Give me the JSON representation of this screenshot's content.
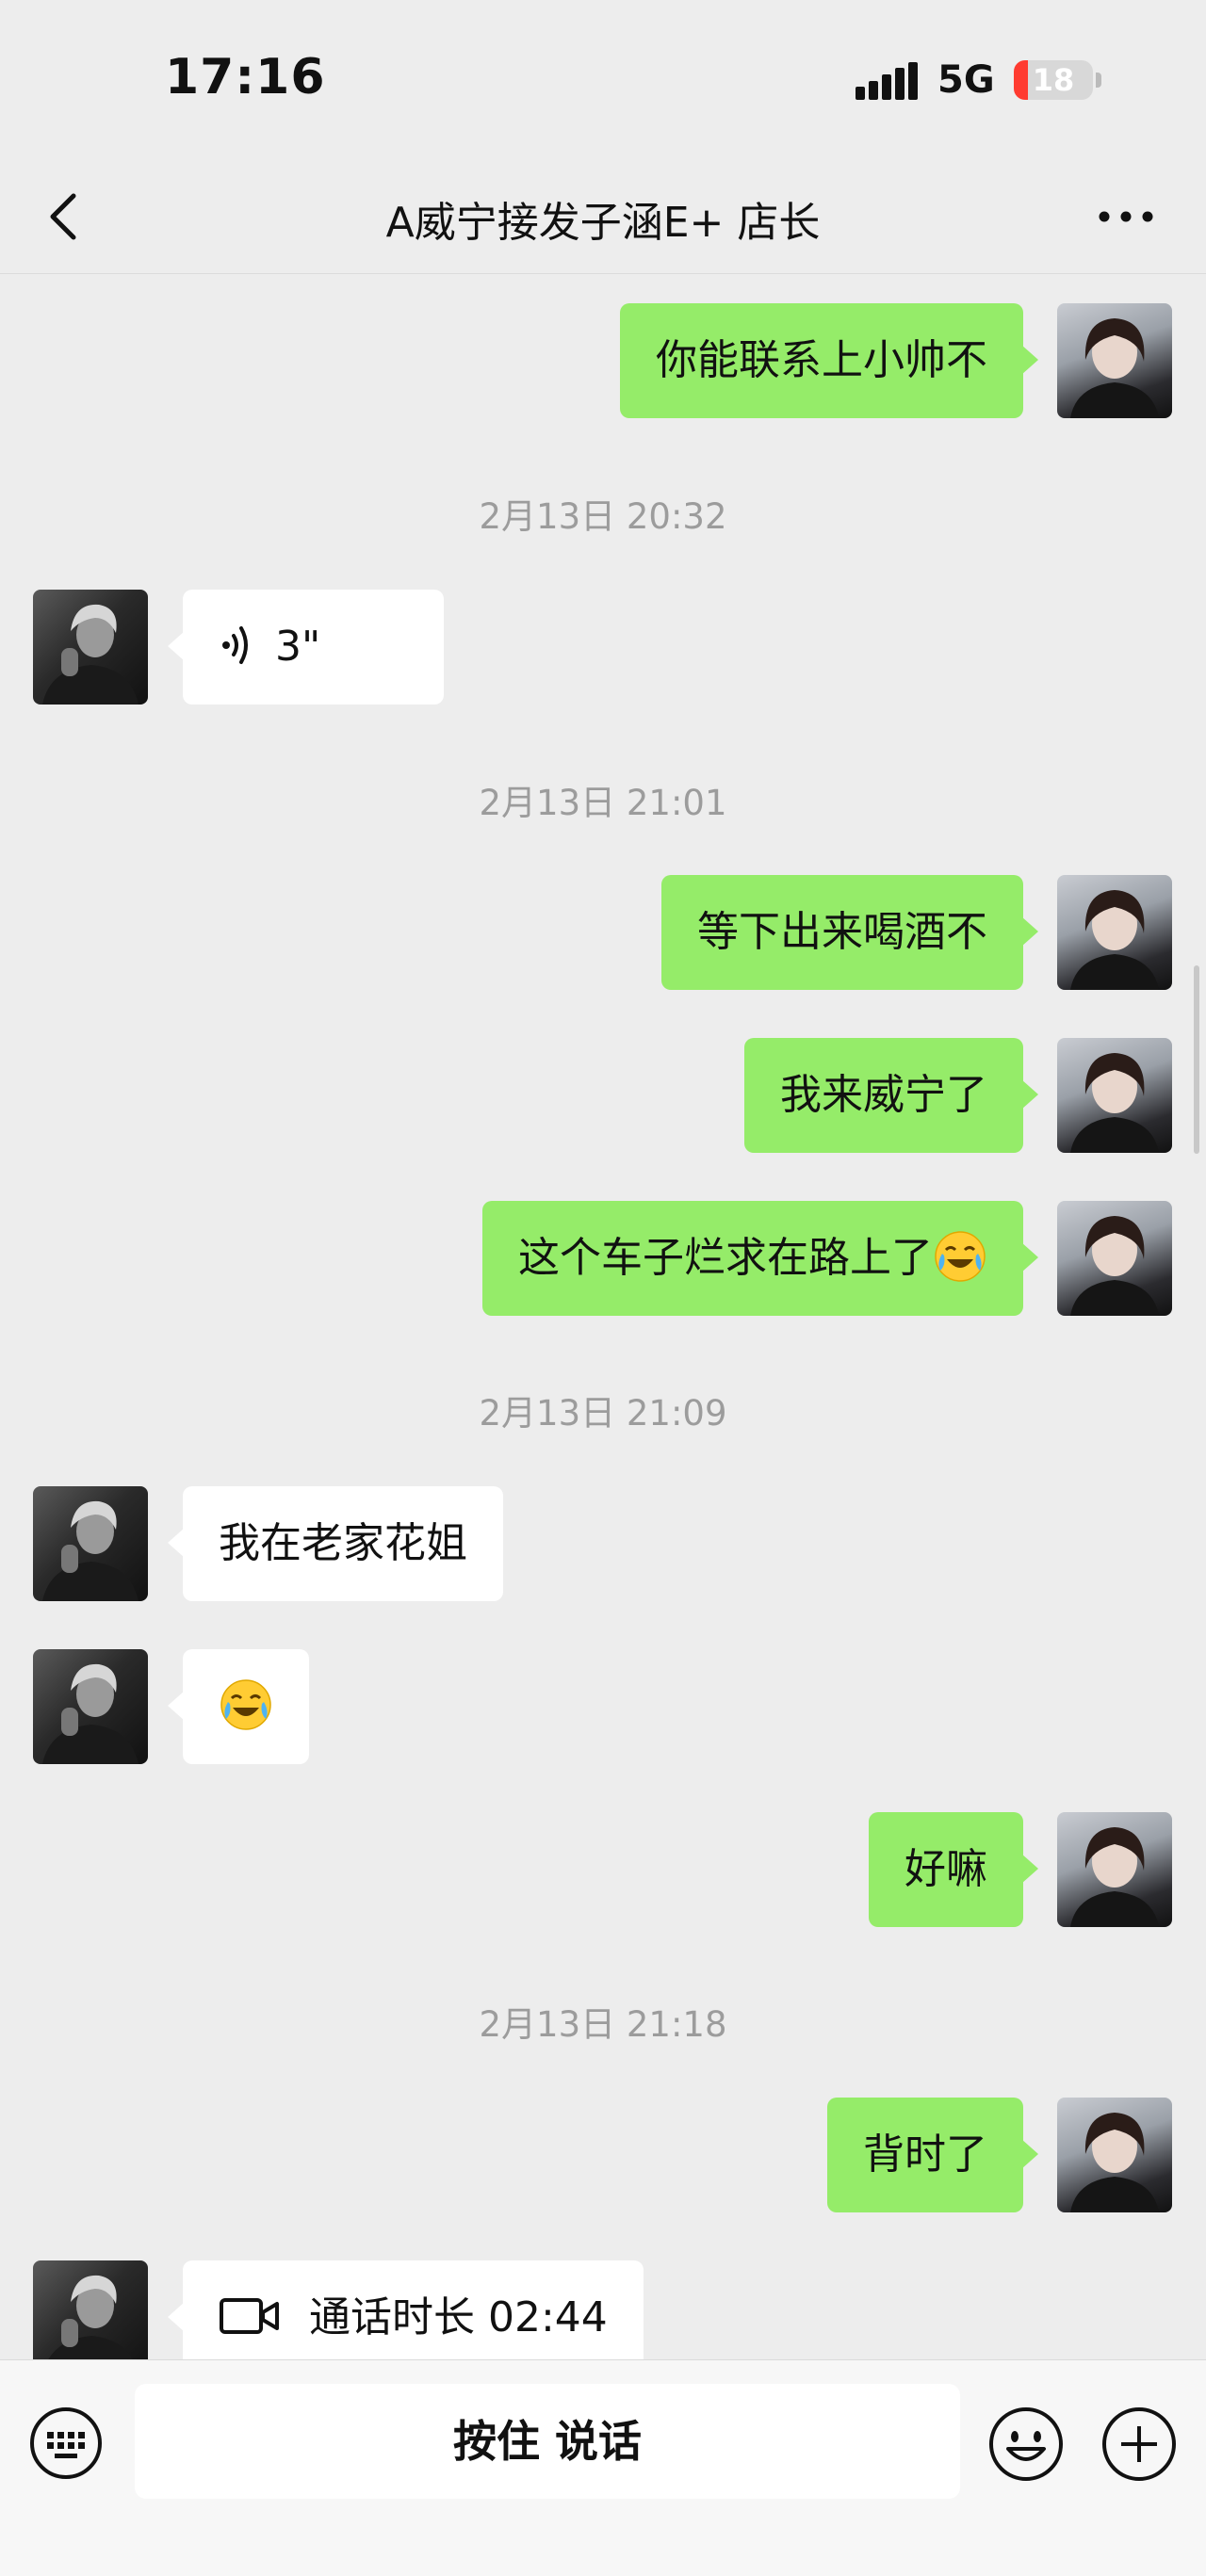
{
  "status_bar": {
    "time": "17:16",
    "network": "5G",
    "battery": "18",
    "battery_level": 0.18
  },
  "header": {
    "title": "A威宁接发子涵E+  店长"
  },
  "messages": [
    {
      "type": "text",
      "side": "me",
      "text": "你能联系上小帅不"
    },
    {
      "type": "timestamp",
      "text": "2月13日 20:32"
    },
    {
      "type": "voice",
      "side": "them",
      "duration": "3\""
    },
    {
      "type": "timestamp",
      "text": "2月13日 21:01"
    },
    {
      "type": "text",
      "side": "me",
      "text": "等下出来喝酒不"
    },
    {
      "type": "text",
      "side": "me",
      "text": "我来威宁了"
    },
    {
      "type": "text",
      "side": "me",
      "text": "这个车子烂求在路上了",
      "emoji": "crying-laughing-emoji"
    },
    {
      "type": "timestamp",
      "text": "2月13日 21:09"
    },
    {
      "type": "text",
      "side": "them",
      "text": "我在老家花姐"
    },
    {
      "type": "emoji",
      "side": "them",
      "emoji": "tears-of-joy-emoji"
    },
    {
      "type": "text",
      "side": "me",
      "text": "好嘛"
    },
    {
      "type": "timestamp",
      "text": "2月13日 21:18"
    },
    {
      "type": "text",
      "side": "me",
      "text": "背时了"
    },
    {
      "type": "video_call",
      "side": "them",
      "text": "通话时长 02:44"
    }
  ],
  "input_bar": {
    "hold_to_talk": "按住 说话"
  },
  "colors": {
    "background": "#ededed",
    "my_bubble": "#95ec69",
    "their_bubble": "#ffffff",
    "timestamp": "#9c9c9c"
  }
}
